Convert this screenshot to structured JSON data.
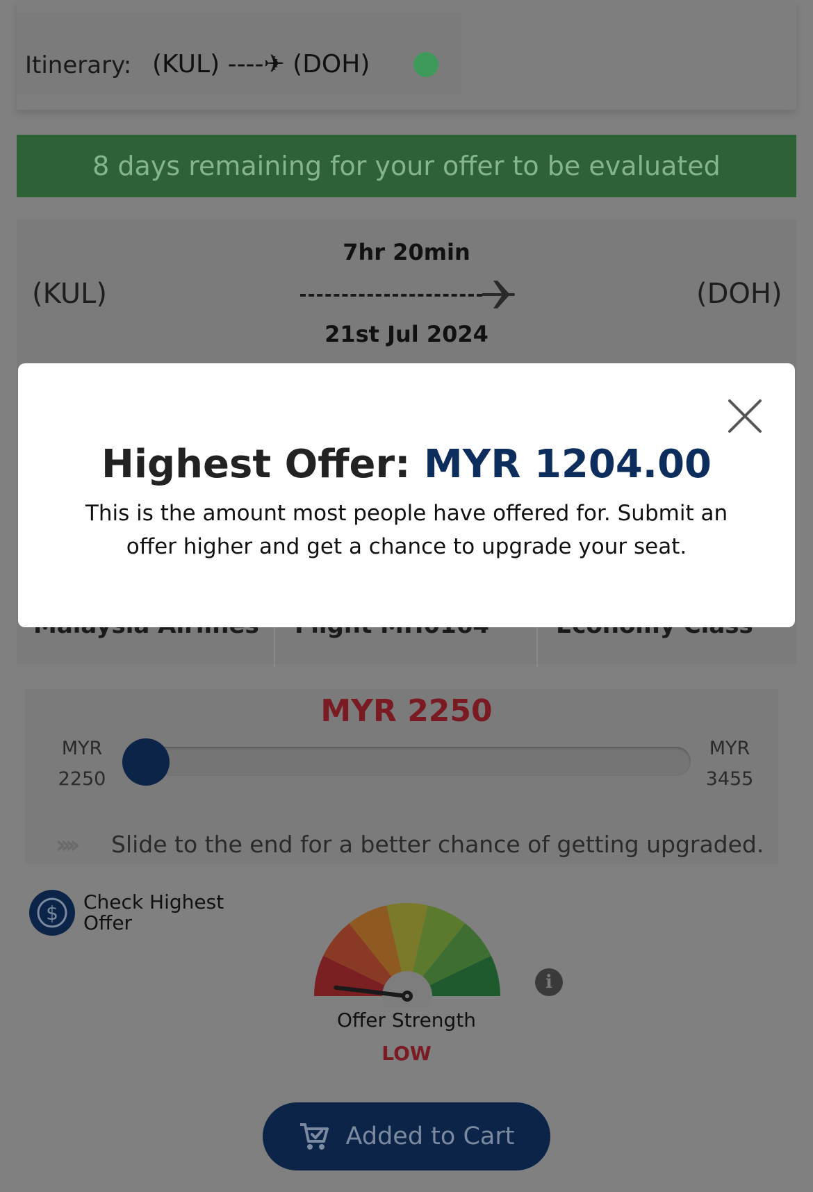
{
  "itinerary": {
    "label": "Itinerary:",
    "route": "(KUL) ----✈ (DOH)",
    "status_color": "#3e9a5a"
  },
  "banner": {
    "text": "8 days remaining for your offer to be evaluated",
    "color": "#2e6135"
  },
  "flight": {
    "origin": "(KUL)",
    "destination": "(DOH)",
    "duration": "7hr 20min",
    "date": "21st Jul 2024",
    "airline": "Malaysia Airlines",
    "flight_number": "Flight MH0164",
    "cabin": "Economy Class"
  },
  "offer": {
    "current_amount": "MYR 2250",
    "min_currency": "MYR",
    "min_value": "2250",
    "max_currency": "MYR",
    "max_value": "3455",
    "slider_fraction": 0.0,
    "hint": "Slide to the end for a better chance of getting upgraded.",
    "hint_chevrons": "››››"
  },
  "check_highest": {
    "label_line1": "Check Highest",
    "label_line2": "Offer",
    "icon": "dollar-coin-icon"
  },
  "strength": {
    "label": "Offer Strength",
    "value": "LOW",
    "level_fraction": 0.05,
    "info_icon": "info-icon"
  },
  "cart": {
    "label": "Added to Cart",
    "icon": "cart-check-icon"
  },
  "modal": {
    "title_prefix": "Highest Offer: ",
    "title_amount": "MYR 1204.00",
    "body": "This is the amount most people have offered for. Submit an offer higher and get a chance to upgrade your seat.",
    "accent_color": "#0d2d5c"
  }
}
